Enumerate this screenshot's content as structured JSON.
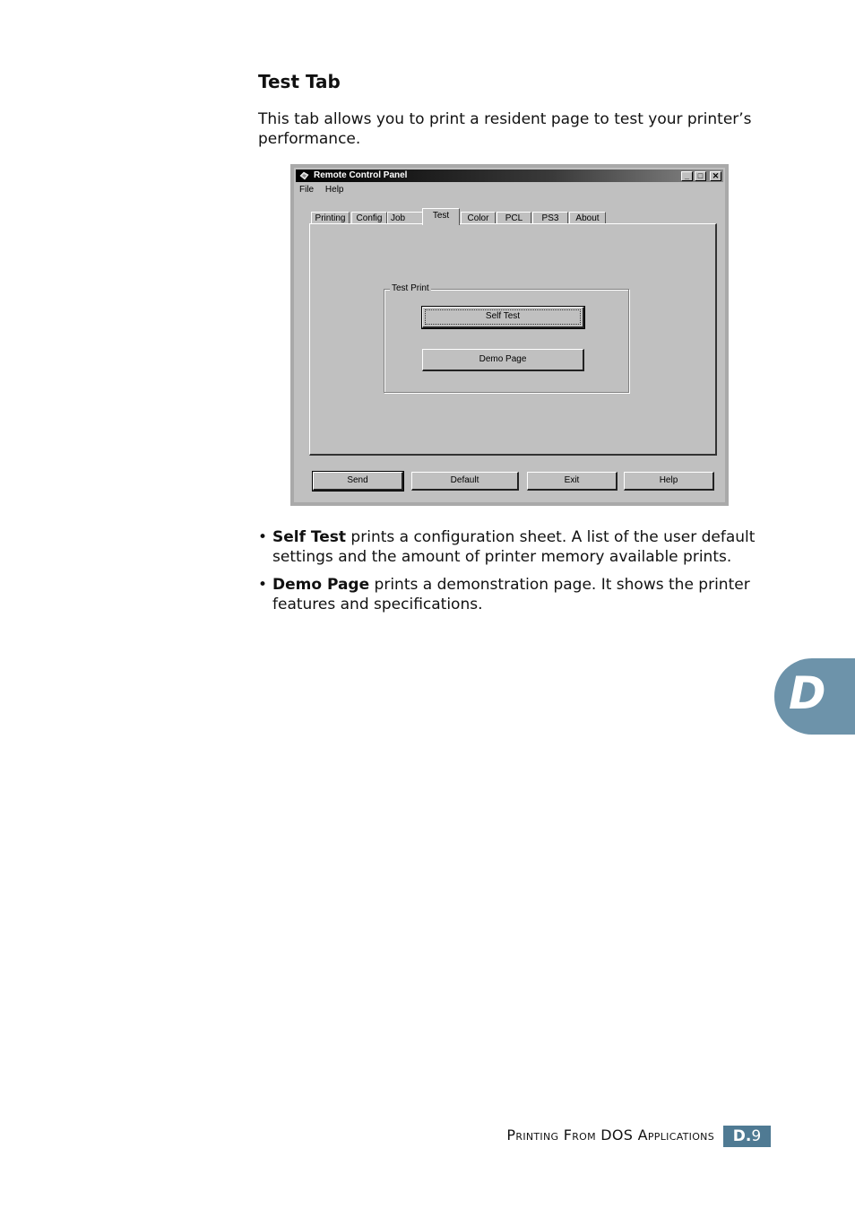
{
  "section": {
    "heading": "Test Tab",
    "intro": "This tab allows you to print a resident page to test your printer’s performance."
  },
  "dialog": {
    "title": "Remote Control Panel",
    "window_buttons": [
      "_",
      "□",
      "✕"
    ],
    "menu": [
      "File",
      "Help"
    ],
    "tabs": [
      "Printing",
      "Config",
      "Job",
      "Test",
      "Color",
      "PCL",
      "PS3",
      "About"
    ],
    "active_tab": "Test",
    "group_label": "Test Print",
    "self_test_label": "Self Test",
    "demo_page_label": "Demo Page",
    "buttons": [
      "Send",
      "Default",
      "Exit",
      "Help"
    ]
  },
  "bullets": [
    {
      "term": "Self Test",
      "text": " prints a configuration sheet. A list of the user default settings and the amount of printer memory available prints."
    },
    {
      "term": "Demo Page",
      "text": " prints a demonstration page. It shows the printer features and specifications."
    }
  ],
  "side_tab_letter": "D",
  "footer": {
    "chapter": "Printing From DOS Applications",
    "page_prefix": "D.",
    "page_number": "9"
  },
  "colors": {
    "accent": "#6d93aa",
    "badge": "#4f7a93",
    "window_face": "#c0c0c0"
  }
}
